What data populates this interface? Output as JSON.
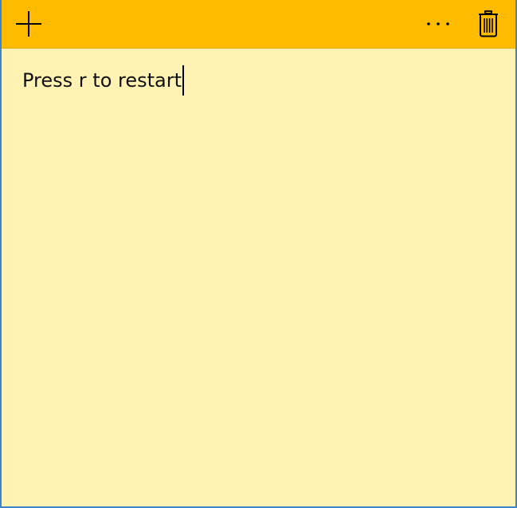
{
  "note": {
    "text": "Press r to restart"
  },
  "toolbar": {
    "add_icon": "plus-icon",
    "more_icon": "ellipsis-icon",
    "delete_icon": "trash-icon"
  },
  "colors": {
    "title_bar": "#ffbb00",
    "note_background": "#fff2b3",
    "window_border": "#3a86c8"
  }
}
